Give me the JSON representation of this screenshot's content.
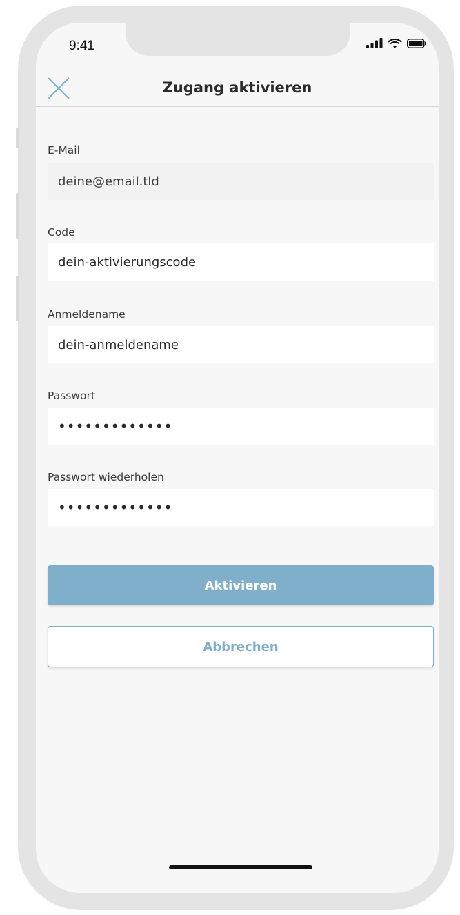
{
  "status_bar": {
    "time": "9:41",
    "icons": [
      "signal-icon",
      "wifi-icon",
      "battery-icon"
    ]
  },
  "header": {
    "title": "Zugang aktivieren",
    "close_icon": "close-icon"
  },
  "form": {
    "email": {
      "label": "E-Mail",
      "value": "deine@email.tld",
      "readonly": true
    },
    "code": {
      "label": "Code",
      "value": "dein-aktivierungscode"
    },
    "username": {
      "label": "Anmeldename",
      "value": "dein-anmeldename"
    },
    "password": {
      "label": "Passwort",
      "value": "•••••••••••••"
    },
    "password_repeat": {
      "label": "Passwort wiederholen",
      "value": "•••••••••••••"
    }
  },
  "actions": {
    "primary_label": "Aktivieren",
    "secondary_label": "Abbrechen"
  },
  "colors": {
    "accent": "#80afcc",
    "background": "#f7f7f7",
    "field": "#ffffff",
    "readonly_field": "#f2f2f2"
  }
}
